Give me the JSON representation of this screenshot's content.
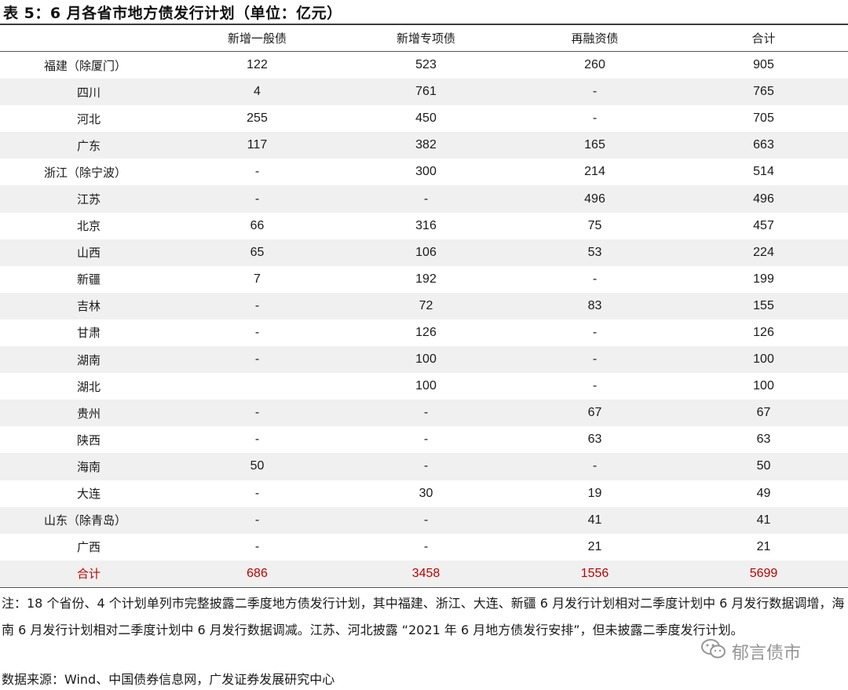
{
  "title": "表 5：6 月各省市地方债发行计划（单位：亿元）",
  "columns": [
    "",
    "新增一般债",
    "新增专项债",
    "再融资债",
    "合计"
  ],
  "rows": [
    {
      "name": "福建（除厦门）",
      "c1": "122",
      "c2": "523",
      "c3": "260",
      "c4": "905"
    },
    {
      "name": "四川",
      "c1": "4",
      "c2": "761",
      "c3": "-",
      "c4": "765"
    },
    {
      "name": "河北",
      "c1": "255",
      "c2": "450",
      "c3": "-",
      "c4": "705"
    },
    {
      "name": "广东",
      "c1": "117",
      "c2": "382",
      "c3": "165",
      "c4": "663"
    },
    {
      "name": "浙江（除宁波）",
      "c1": "-",
      "c2": "300",
      "c3": "214",
      "c4": "514"
    },
    {
      "name": "江苏",
      "c1": "-",
      "c2": "-",
      "c3": "496",
      "c4": "496"
    },
    {
      "name": "北京",
      "c1": "66",
      "c2": "316",
      "c3": "75",
      "c4": "457"
    },
    {
      "name": "山西",
      "c1": "65",
      "c2": "106",
      "c3": "53",
      "c4": "224"
    },
    {
      "name": "新疆",
      "c1": "7",
      "c2": "192",
      "c3": "-",
      "c4": "199"
    },
    {
      "name": "吉林",
      "c1": "-",
      "c2": "72",
      "c3": "83",
      "c4": "155"
    },
    {
      "name": "甘肃",
      "c1": "-",
      "c2": "126",
      "c3": "-",
      "c4": "126"
    },
    {
      "name": "湖南",
      "c1": "-",
      "c2": "100",
      "c3": "-",
      "c4": "100"
    },
    {
      "name": "湖北",
      "c1": "",
      "c2": "100",
      "c3": "-",
      "c4": "100"
    },
    {
      "name": "贵州",
      "c1": "-",
      "c2": "-",
      "c3": "67",
      "c4": "67"
    },
    {
      "name": "陕西",
      "c1": "-",
      "c2": "-",
      "c3": "63",
      "c4": "63"
    },
    {
      "name": "海南",
      "c1": "50",
      "c2": "-",
      "c3": "-",
      "c4": "50"
    },
    {
      "name": "大连",
      "c1": "-",
      "c2": "30",
      "c3": "19",
      "c4": "49"
    },
    {
      "name": "山东（除青岛）",
      "c1": "-",
      "c2": "-",
      "c3": "41",
      "c4": "41"
    },
    {
      "name": "广西",
      "c1": "-",
      "c2": "-",
      "c3": "21",
      "c4": "21"
    }
  ],
  "total": {
    "name": "合计",
    "c1": "686",
    "c2": "3458",
    "c3": "1556",
    "c4": "5699"
  },
  "note": "注：18 个省份、4 个计划单列市完整披露二季度地方债发行计划，其中福建、浙江、大连、新疆 6 月发行计划相对二季度计划中 6 月发行数据调增，海南 6 月发行计划相对二季度计划中 6 月发行数据调减。江苏、河北披露 “2021 年 6 月地方债发行安排”，但未披露二季度发行计划。",
  "source": "数据来源：Wind、中国债券信息网，广发证券发展研究中心",
  "watermark": "郁言债市",
  "colors": {
    "total_text": "#c00000",
    "stripe": "#f0f0f0"
  }
}
